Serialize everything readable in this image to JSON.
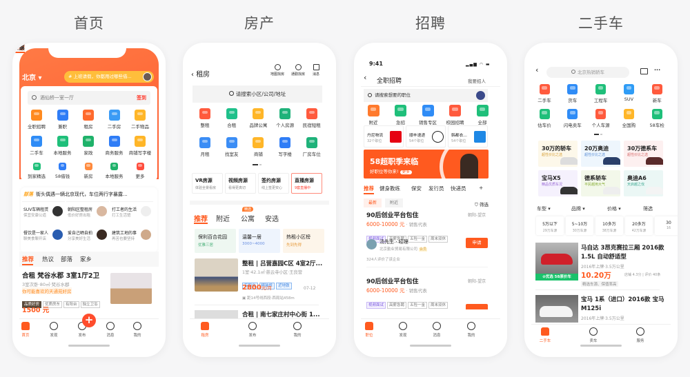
{
  "section_titles": [
    "首页",
    "房产",
    "招聘",
    "二手车"
  ],
  "colors": {
    "accent": "#ff5a1f",
    "header_orange": "#ff5f33",
    "banner_yellow": "#ffbe3b",
    "green": "#19c26b"
  },
  "home": {
    "city": "北京 ▾",
    "banner": "# 上班请假，你都用过哪些借...",
    "search_placeholder": "酒仙桥一室一厅",
    "sign_in": "签到",
    "grid": [
      {
        "label": "全职招聘",
        "color": "#ff8a1f"
      },
      {
        "label": "兼职",
        "color": "#2f7df6"
      },
      {
        "label": "租房",
        "color": "#ff6a2d"
      },
      {
        "label": "二手房",
        "color": "#3b9bf5"
      },
      {
        "label": "二手物品",
        "color": "#ffb628"
      },
      {
        "label": "二手车",
        "color": "#2f8cf6"
      },
      {
        "label": "本地服务",
        "color": "#1fbf7a"
      },
      {
        "label": "家政",
        "color": "#1fb26a"
      },
      {
        "label": "商务服务",
        "color": "#2f7df6"
      },
      {
        "label": "商铺写字楼",
        "color": "#ffb628"
      }
    ],
    "small_grid": [
      {
        "label": "到家精选",
        "color": "#1fbf7a"
      },
      {
        "label": "58借钱",
        "color": "#2f7df6"
      },
      {
        "label": "新房",
        "color": "#ff8a3d"
      },
      {
        "label": "本地服务",
        "color": "#1fb26a"
      },
      {
        "label": "更多",
        "color": "#ff4d3d"
      }
    ],
    "news_badge": "部落",
    "news_text": "街头偶遇一辆北京现代，车位两行字暴露...",
    "cards": [
      {
        "title": "SUV车辆租赁",
        "sub": "保宜安康公道"
      },
      {
        "title": "朝阳区整租房",
        "sub": "低价好房出租"
      },
      {
        "title": "打工者的生活",
        "sub": "打工生活馆"
      },
      {
        "title": "餐饮是一家人",
        "sub": "聊美食聊开店"
      },
      {
        "title": "爱自己晒自拍",
        "sub": "分享美好生活"
      },
      {
        "title": "建筑工地的事",
        "sub": "再苦也要坚持"
      }
    ],
    "tabs": [
      "推荐",
      "热议",
      "部落",
      "家乡"
    ],
    "listing": {
      "title": "合租 梵谷水郡 3室1厅2卫",
      "sub": "3室次卧·80㎡·梵谷水郡",
      "hint": "你可能喜欢的天通苑好房",
      "tags": [
        "品质好房",
        "优质房东",
        "有阳台",
        "独立卫浴"
      ],
      "price": "1500 元"
    },
    "nav": [
      "首页",
      "发现",
      "发布",
      "消息",
      "我的"
    ]
  },
  "house": {
    "title": "租房",
    "top_icons": [
      "地图找房",
      "通勤找房",
      "消息"
    ],
    "search_placeholder": "请搜索小区/公司/地址",
    "grid": [
      {
        "label": "整租",
        "color": "#ff5a3d"
      },
      {
        "label": "合租",
        "color": "#1fc08a"
      },
      {
        "label": "品牌公寓",
        "color": "#ffb628"
      },
      {
        "label": "个人房源",
        "color": "#1fb27a"
      },
      {
        "label": "民宿短租",
        "color": "#ff5a3d"
      },
      {
        "label": "月租",
        "color": "#3b8df5"
      },
      {
        "label": "找室友",
        "color": "#3b8df5"
      },
      {
        "label": "商铺",
        "color": "#ffb628"
      },
      {
        "label": "写字楼",
        "color": "#2f7df6"
      },
      {
        "label": "厂房车位",
        "color": "#1fb27a"
      }
    ],
    "features": [
      {
        "title": "VR房源",
        "sub": "体验全景看房"
      },
      {
        "title": "视频房源",
        "sub": "看得更真切"
      },
      {
        "title": "签约房源",
        "sub": "线上签更安心"
      },
      {
        "title": "直播房源",
        "sub": "9套直播中"
      }
    ],
    "tabs": [
      "推荐",
      "附近",
      "公寓",
      "安选"
    ],
    "tab_badge": "精选",
    "mini_cards": [
      {
        "title": "保利百合花园",
        "sub": "优雅三居",
        "bg": "#eef7f1",
        "color": "#4bb07a"
      },
      {
        "title": "温馨一居",
        "sub": "3000~4000",
        "bg": "#eef4fd",
        "color": "#6a8fe0"
      },
      {
        "title": "热租小区榜",
        "sub": "先到先得",
        "bg": "#fdf5ea",
        "color": "#e69a3a"
      }
    ],
    "listings": [
      {
        "title": "整租 | 吕营嘉园C区 4室2厅...",
        "sub": "1室·42.1㎡·慈云寺小区·王良营",
        "tags": [
          "有阳台",
          "精装修",
          "近地铁"
        ],
        "price": "2800",
        "unit": "元/月",
        "date": "07-12",
        "subway": "距14号线西段-西局站458m"
      },
      {
        "title": "合租 | 南七家庄村中心街 1..."
      }
    ],
    "nav": [
      "租房",
      "发布",
      "我的"
    ]
  },
  "jobs": {
    "time": "9:41",
    "title": "全职招聘",
    "post_job": "我要招人",
    "search_placeholder": "请搜索想要的职位",
    "grid": [
      {
        "label": "附近",
        "color": "#ff7a2d"
      },
      {
        "label": "急招",
        "color": "#1fbf7a"
      },
      {
        "label": "销售专区",
        "color": "#2f8cf6"
      },
      {
        "label": "校园招聘",
        "color": "#ff5a3d"
      },
      {
        "label": "全部",
        "color": "#1fbf7a"
      }
    ],
    "brands": [
      {
        "name": "丹尼物流",
        "count": "32个职位",
        "logo": "UNI QLO",
        "color": "#e60012"
      },
      {
        "name": "顺丰速递",
        "count": "54个职位",
        "logo": "SF",
        "color": "#222222"
      },
      {
        "name": "韩都衣...",
        "count": "54个职位",
        "logo": "C",
        "color": "#1e88e5"
      }
    ],
    "banner_title": "58超职季来临",
    "banner_sub": "好职位等你来!",
    "banner_more": "更多",
    "tabs": [
      "推荐",
      "健身教练",
      "保安",
      "发行员",
      "快递员",
      "+"
    ],
    "chips": [
      "最新",
      "附近"
    ],
    "filter": "筛选",
    "jobs": [
      {
        "title": "90后创业平台包住",
        "location": "朝阳-望京",
        "salary": "6000-10000 元",
        "role": " · 销售代表",
        "tags": [
          "视频面试",
          "高薪急聘",
          "五险一金",
          "周末双休"
        ],
        "apply": "申请",
        "recruiter": "汤先生 · 经理",
        "company": "北京勤业贸易有限公司",
        "member": "会员",
        "reviews": "324人评价了该企业"
      },
      {
        "title": "90后创业平台包住",
        "location": "朝阳-望京",
        "salary": "6000-10000 元",
        "role": " · 销售代表",
        "tags": [
          "视频面试",
          "高薪急聘",
          "五险一金",
          "周末双休"
        ]
      }
    ],
    "nav": [
      "职位",
      "发现",
      "消息",
      "我的"
    ]
  },
  "cars": {
    "search_placeholder": "北京热销轿车",
    "grid": [
      {
        "label": "二手车",
        "color": "#ff5a3d"
      },
      {
        "label": "货车",
        "color": "#2f8cf6"
      },
      {
        "label": "工程车",
        "color": "#1fbf7a"
      },
      {
        "label": "SUV",
        "color": "#2f9cf6"
      },
      {
        "label": "新车",
        "color": "#ff5a3d"
      },
      {
        "label": "估车价",
        "color": "#1fbf7a"
      },
      {
        "label": "闪电卖车",
        "color": "#2f8cf6"
      },
      {
        "label": "个人车源",
        "color": "#ff5a3d"
      },
      {
        "label": "全国购",
        "color": "#ffb628"
      },
      {
        "label": "58车检",
        "color": "#1fbf7a"
      }
    ],
    "promos": [
      {
        "title": "30万的轿车",
        "sub": "超性价比之选",
        "bg": "#fdf8ea",
        "color": "#d8a23a"
      },
      {
        "title": "20万奥迪",
        "sub": "超性价比之选",
        "bg": "#eef6fd",
        "color": "#5b8fd6"
      },
      {
        "title": "30万德系车",
        "sub": "超性价比之选",
        "bg": "#fdf0f0",
        "color": "#d66a6a"
      },
      {
        "title": "宝马X5",
        "sub": "精品优质车况",
        "bg": "#f5f1fd",
        "color": "#9a6ad6"
      },
      {
        "title": "德系轿车",
        "sub": "平民越用大气",
        "bg": "#f3f8ea",
        "color": "#8ab03a"
      },
      {
        "title": "奥迪A6",
        "sub": "天启越之伐",
        "bg": "#ebf7f5",
        "color": "#3aa890"
      }
    ],
    "filters": [
      "车型 ▾",
      "品牌 ▾",
      "价格 ▾",
      "筛选"
    ],
    "price_chips": [
      {
        "label": "5万以下",
        "sub": "29万车源"
      },
      {
        "label": "5~10万",
        "sub": "30万车源"
      },
      {
        "label": "10多万",
        "sub": "38万车源"
      },
      {
        "label": "20多万",
        "sub": "42万车源"
      },
      {
        "label": "30",
        "sub": "16"
      }
    ],
    "listings": [
      {
        "title": "马自达 3昂克赛拉三厢 2016款 1.5L 自动舒适型",
        "sub": "2016年上牌·3.5万公里",
        "price": "10.20万",
        "shop": "店铺 4.3分 | 评价 40条",
        "tags": "精选车源、保值率高",
        "badge": "⊘优选 58原价车"
      },
      {
        "title": "宝马 1系（进口）2016款 宝马M125i",
        "sub": "2016年上牌·3.5万公里"
      }
    ],
    "nav": [
      "二手车",
      "卖车",
      "服务"
    ]
  }
}
